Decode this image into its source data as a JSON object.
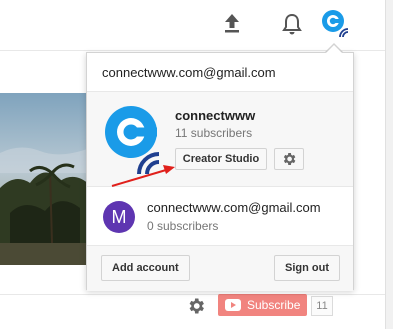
{
  "header": {
    "icons": [
      "upload-icon",
      "notifications-bell-icon",
      "account-avatar-icon"
    ]
  },
  "account_menu": {
    "email": "connectwww.com@gmail.com",
    "current_channel": {
      "name": "connectwww",
      "subscribers": "11 subscribers",
      "creator_studio_label": "Creator Studio",
      "settings_icon": "gear-icon"
    },
    "other_account": {
      "avatar_letter": "M",
      "avatar_color": "#5e35b1",
      "email": "connectwww.com@gmail.com",
      "subscribers": "0 subscribers"
    },
    "add_account_label": "Add account",
    "sign_out_label": "Sign out"
  },
  "page": {
    "subscribe_label": "Subscribe",
    "subscriber_count": "11"
  },
  "colors": {
    "brand_blue": "#1a9be8",
    "dark_blue": "#1f3f8f",
    "annotation_arrow": "#e0201b",
    "subscribe_red": "#e62117"
  }
}
